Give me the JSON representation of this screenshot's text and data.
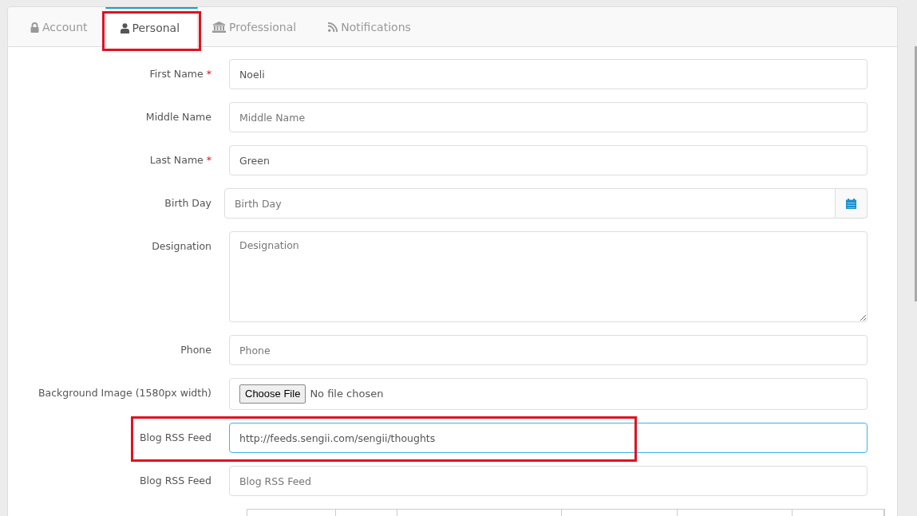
{
  "tabs": [
    {
      "label": "Account",
      "selected": false,
      "highlighted": false
    },
    {
      "label": "Personal",
      "selected": true,
      "highlighted": true
    },
    {
      "label": "Professional",
      "selected": false,
      "highlighted": false
    },
    {
      "label": "Notifications",
      "selected": false,
      "highlighted": false
    }
  ],
  "fields": [
    {
      "kind": "text",
      "label": "First Name",
      "required_mark": "*",
      "value": "Noeli"
    },
    {
      "kind": "text",
      "label": "Middle Name",
      "placeholder": "Middle Name"
    },
    {
      "kind": "text",
      "label": "Last Name",
      "required_mark": "*",
      "value": "Green"
    },
    {
      "kind": "date",
      "label": "Birth Day",
      "placeholder": "Birth Day"
    },
    {
      "kind": "textarea",
      "label": "Designation",
      "placeholder": "Designation"
    },
    {
      "kind": "text",
      "label": "Phone",
      "placeholder": "Phone"
    },
    {
      "kind": "file",
      "label": "Background Image (1580px width)",
      "button": "Choose File",
      "status": "No file chosen"
    },
    {
      "kind": "text",
      "label": "Blog RSS Feed",
      "value": "http://feeds.sengii.com/sengii/thoughts",
      "focused": true,
      "highlighted": true
    },
    {
      "kind": "text",
      "label": "Blog RSS Feed",
      "placeholder": "Blog RSS Feed"
    }
  ]
}
